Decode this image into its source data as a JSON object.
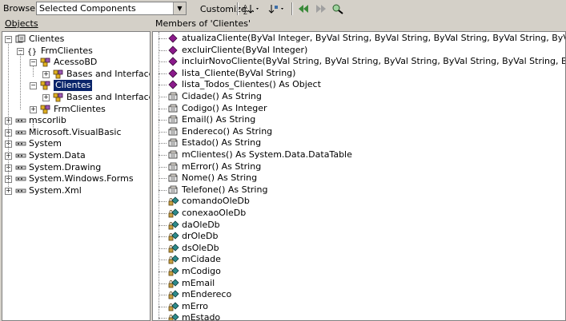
{
  "toolbar": {
    "browse_label": "Browse:",
    "browse_value": "Selected Components",
    "customize_label": "Customize..."
  },
  "objects_pane": {
    "header": "Objects",
    "tree": [
      {
        "label": "Clientes",
        "level": 0,
        "icon": "assembly-icon",
        "expander": "-"
      },
      {
        "label": "FrmClientes",
        "level": 1,
        "icon": "namespace-icon",
        "expander": "-"
      },
      {
        "label": "AcessoBD",
        "level": 2,
        "icon": "class-icon",
        "expander": "-"
      },
      {
        "label": "Bases and Interfaces",
        "level": 3,
        "icon": "class-icon",
        "expander": "+"
      },
      {
        "label": "Clientes",
        "level": 2,
        "icon": "class-icon",
        "expander": "-",
        "selected": true
      },
      {
        "label": "Bases and Interfaces",
        "level": 3,
        "icon": "class-icon",
        "expander": "+"
      },
      {
        "label": "FrmClientes",
        "level": 2,
        "icon": "class-icon",
        "expander": "+"
      },
      {
        "label": "mscorlib",
        "level": 0,
        "icon": "reference-icon",
        "expander": "+"
      },
      {
        "label": "Microsoft.VisualBasic",
        "level": 0,
        "icon": "reference-icon",
        "expander": "+"
      },
      {
        "label": "System",
        "level": 0,
        "icon": "reference-icon",
        "expander": "+"
      },
      {
        "label": "System.Data",
        "level": 0,
        "icon": "reference-icon",
        "expander": "+"
      },
      {
        "label": "System.Drawing",
        "level": 0,
        "icon": "reference-icon",
        "expander": "+"
      },
      {
        "label": "System.Windows.Forms",
        "level": 0,
        "icon": "reference-icon",
        "expander": "+"
      },
      {
        "label": "System.Xml",
        "level": 0,
        "icon": "reference-icon",
        "expander": "+"
      }
    ]
  },
  "members_pane": {
    "header": "Members of 'Clientes'",
    "members": [
      {
        "label": "atualizaCliente(ByVal Integer, ByVal String, ByVal String, ByVal String, ByVal String, ByVal String, ByVal String)",
        "icon": "method-icon"
      },
      {
        "label": "excluirCliente(ByVal Integer)",
        "icon": "method-icon"
      },
      {
        "label": "incluirNovoCliente(ByVal String, ByVal String, ByVal String, ByVal String, ByVal String, ByVal String)",
        "icon": "method-icon"
      },
      {
        "label": "lista_Cliente(ByVal String)",
        "icon": "method-icon"
      },
      {
        "label": "lista_Todos_Clientes() As Object",
        "icon": "method-icon"
      },
      {
        "label": "Cidade() As String",
        "icon": "property-icon"
      },
      {
        "label": "Codigo() As Integer",
        "icon": "property-icon"
      },
      {
        "label": "Email() As String",
        "icon": "property-icon"
      },
      {
        "label": "Endereco() As String",
        "icon": "property-icon"
      },
      {
        "label": "Estado() As String",
        "icon": "property-icon"
      },
      {
        "label": "mClientes() As System.Data.DataTable",
        "icon": "property-icon"
      },
      {
        "label": "mError() As String",
        "icon": "property-icon"
      },
      {
        "label": "Nome() As String",
        "icon": "property-icon"
      },
      {
        "label": "Telefone() As String",
        "icon": "property-icon"
      },
      {
        "label": "comandoOleDb",
        "icon": "private-field-icon"
      },
      {
        "label": "conexaoOleDb",
        "icon": "private-field-icon"
      },
      {
        "label": "daOleDb",
        "icon": "private-field-icon"
      },
      {
        "label": "drOleDb",
        "icon": "private-field-icon"
      },
      {
        "label": "dsOleDb",
        "icon": "private-field-icon"
      },
      {
        "label": "mCidade",
        "icon": "private-field-icon"
      },
      {
        "label": "mCodigo",
        "icon": "private-field-icon"
      },
      {
        "label": "mEmail",
        "icon": "private-field-icon"
      },
      {
        "label": "mEndereco",
        "icon": "private-field-icon"
      },
      {
        "label": "mErro",
        "icon": "private-field-icon"
      },
      {
        "label": "mEstado",
        "icon": "private-field-icon"
      }
    ]
  },
  "colors": {
    "selection": "#0a246a",
    "method": "#8b1a8b",
    "field": "#2e8b8b"
  }
}
